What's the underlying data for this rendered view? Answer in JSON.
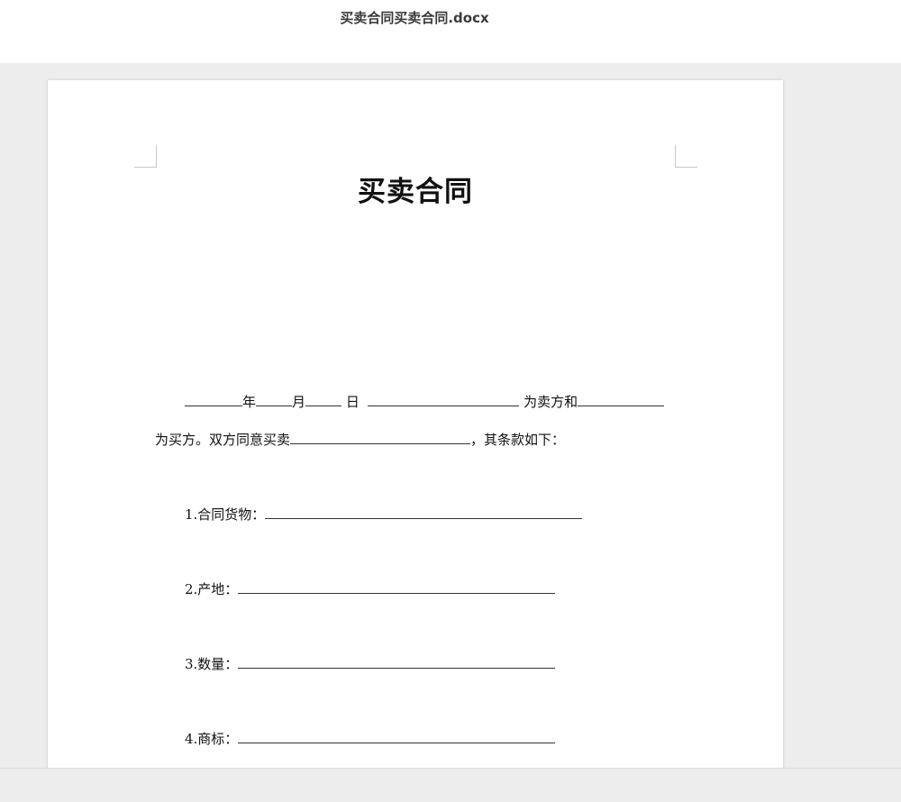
{
  "window": {
    "file_name": "买卖合同买卖合同.docx"
  },
  "document": {
    "heading": "买卖合同",
    "para1": {
      "year_unit": "年",
      "month_unit": "月",
      "day_unit": "日",
      "seller_suffix": "为卖方和"
    },
    "para2": {
      "prefix": "为买方。双方同意买卖",
      "suffix": "，其条款如下："
    },
    "clauses": [
      {
        "label": "1.合同货物："
      },
      {
        "label": "2.产地："
      },
      {
        "label": "3.数量："
      },
      {
        "label": "4.商标："
      }
    ]
  }
}
